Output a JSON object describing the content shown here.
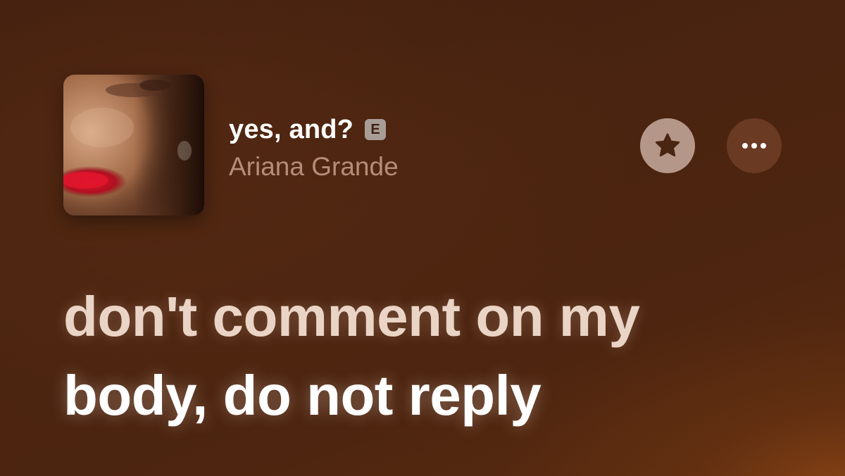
{
  "now_playing": {
    "title": "yes, and?",
    "explicit_badge": "E",
    "artist": "Ariana Grande",
    "artwork_icon": "album-artwork"
  },
  "actions": {
    "favorite_icon": "star-icon",
    "more_icon": "ellipsis-icon"
  },
  "lyrics": {
    "lines": [
      "don't comment on my",
      "body, do not reply"
    ]
  },
  "colors": {
    "background": "#4a2410",
    "glow": "#964a16",
    "artist_text": "#b48e78",
    "favorite_button": "#b5978a",
    "more_button": "#6a3a22"
  }
}
